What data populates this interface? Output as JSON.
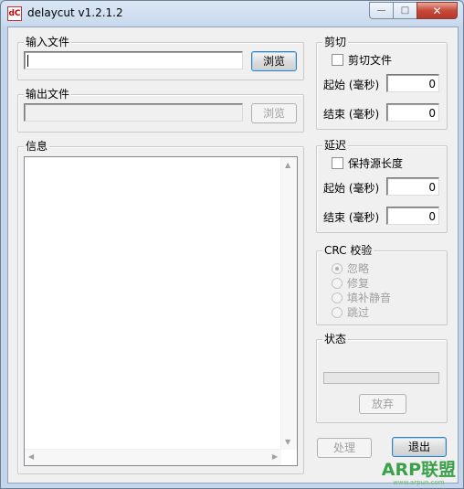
{
  "window": {
    "title": "delaycut v1.2.1.2",
    "icon_text": "dC",
    "min_symbol": "—",
    "max_symbol": "□",
    "close_symbol": "✕"
  },
  "input": {
    "label": "输入文件",
    "value": "",
    "browse_label": "浏览"
  },
  "output": {
    "label": "输出文件",
    "value": "",
    "browse_label": "浏览"
  },
  "info": {
    "label": "信息",
    "content": "",
    "arrow_up": "▲",
    "arrow_down": "▼",
    "arrow_left": "◀",
    "arrow_right": "▶"
  },
  "cut": {
    "label": "剪切",
    "checkbox_label": "剪切文件",
    "start_label": "起始 (毫秒)",
    "start_value": "0",
    "end_label": "结束 (毫秒)",
    "end_value": "0"
  },
  "delay": {
    "label": "延迟",
    "checkbox_label": "保持源长度",
    "start_label": "起始 (毫秒)",
    "start_value": "0",
    "end_label": "结束 (毫秒)",
    "end_value": "0"
  },
  "crc": {
    "label": "CRC 校验",
    "options": [
      "忽略",
      "修复",
      "填补静音",
      "跳过"
    ],
    "selected": "忽略"
  },
  "status": {
    "label": "状态",
    "progress": 0,
    "abort_label": "放弃"
  },
  "actions": {
    "process_label": "处理",
    "exit_label": "退出"
  },
  "watermark": {
    "brand": "ARP联盟",
    "url": "www.arpun.com"
  }
}
